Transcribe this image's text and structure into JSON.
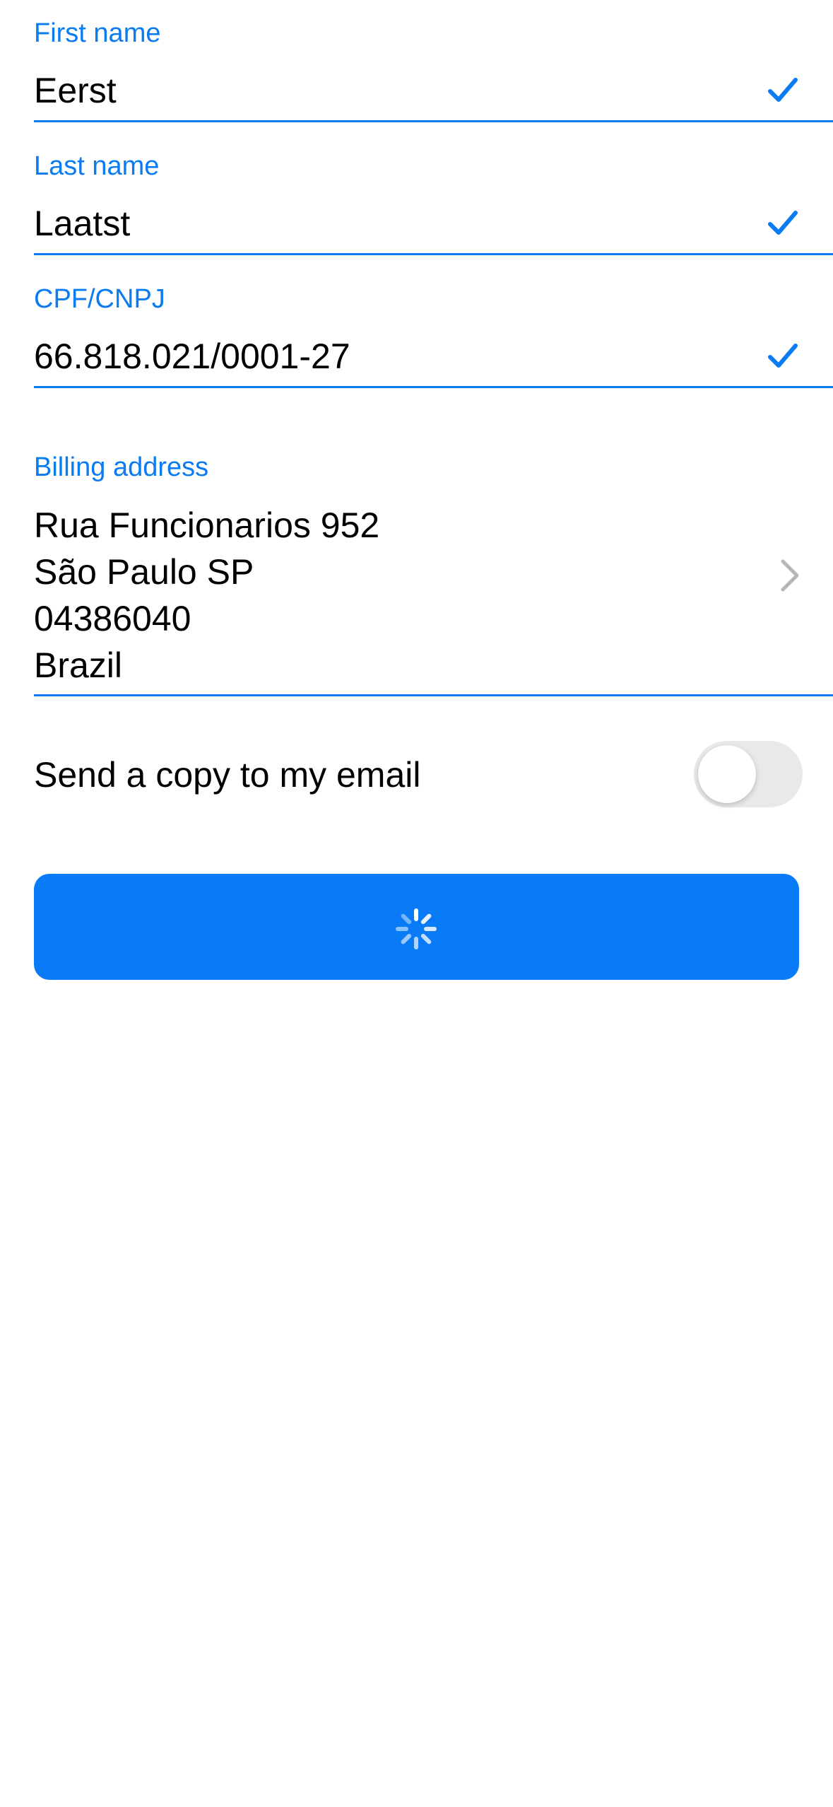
{
  "form": {
    "first_name": {
      "label": "First name",
      "value": "Eerst"
    },
    "last_name": {
      "label": "Last name",
      "value": "Laatst"
    },
    "tax_id": {
      "label": "CPF/CNPJ",
      "value": "66.818.021/0001-27"
    },
    "billing_address": {
      "label": "Billing address",
      "lines": [
        "Rua Funcionarios 952",
        "São Paulo SP",
        "04386040",
        "Brazil"
      ]
    },
    "send_copy": {
      "label": "Send a copy to my email",
      "enabled": false
    }
  },
  "submit_button": {
    "state": "loading",
    "icon": "spinner-icon"
  },
  "colors": {
    "accent": "#0a7bf0",
    "button": "#0a7bf7",
    "toggle_off": "#e9e9eb",
    "chevron": "#b6b6bb"
  }
}
